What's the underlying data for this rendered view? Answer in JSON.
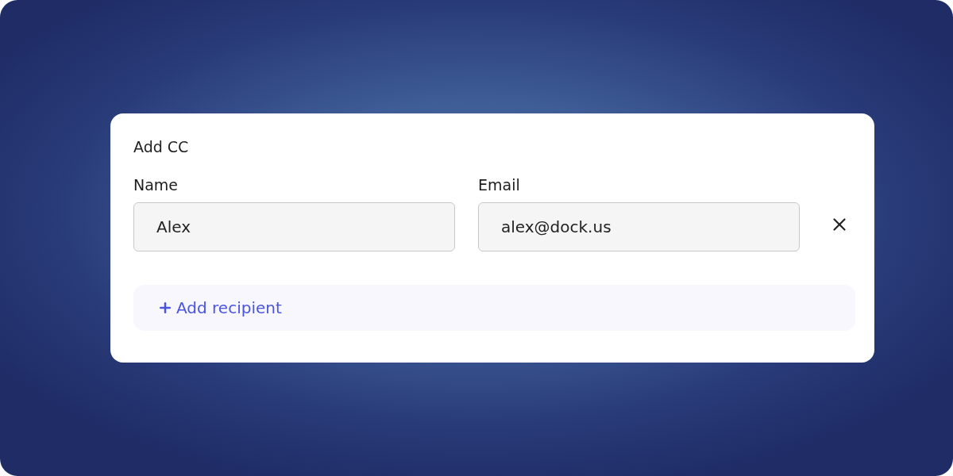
{
  "dialog": {
    "title": "Add CC",
    "fields": [
      {
        "label": "Name",
        "value": "Alex"
      },
      {
        "label": "Email",
        "value": "alex@dock.us"
      }
    ],
    "add_button": {
      "label": "Add recipient"
    }
  }
}
